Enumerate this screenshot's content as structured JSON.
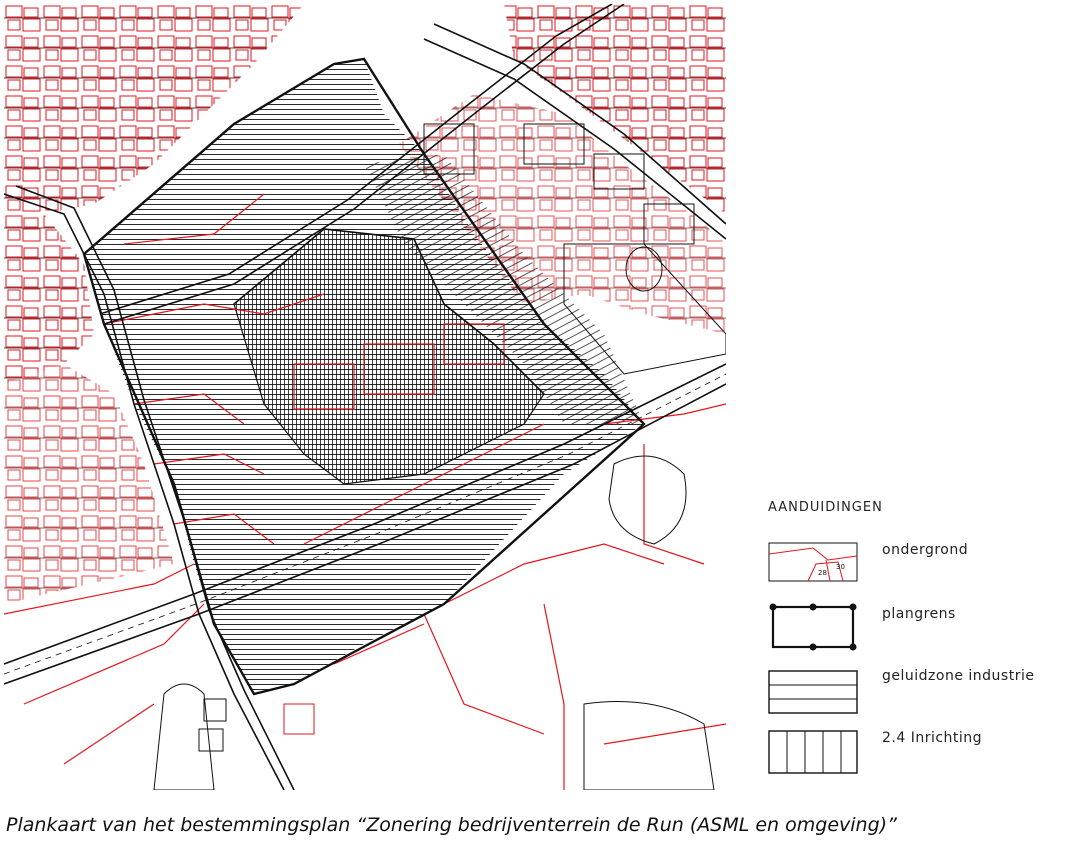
{
  "map": {
    "colors": {
      "parcel": "#e3161c",
      "topo": "#1a1a1a",
      "background": "#ffffff"
    }
  },
  "legend": {
    "title": "AANDUIDINGEN",
    "items": [
      {
        "key": "ondergrond",
        "label": "ondergrond",
        "numbers": [
          "28",
          "30"
        ]
      },
      {
        "key": "plangrens",
        "label": "plangrens"
      },
      {
        "key": "geluidzone",
        "label": "geluidzone industrie"
      },
      {
        "key": "inrichting",
        "label": "2.4 Inrichting"
      }
    ]
  },
  "caption": "Plankaart van het bestemmingsplan “Zonering bedrijventerrein de Run (ASML en omgeving)”"
}
